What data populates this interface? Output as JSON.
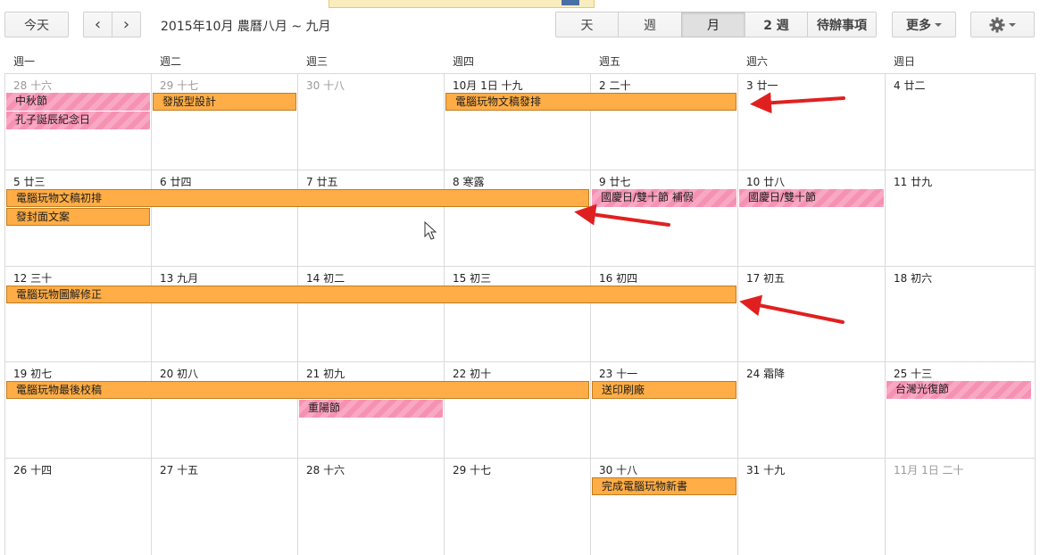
{
  "toolbar": {
    "today": "今天",
    "prev": "‹",
    "next": "›",
    "title": "2015年10月 農曆八月 ~ 九月",
    "views": [
      "天",
      "週",
      "月",
      "2 週",
      "待辦事項"
    ],
    "selected_view": "月",
    "more": "更多",
    "settings_icon": "gear-icon"
  },
  "weekdays": [
    "週一",
    "週二",
    "週三",
    "週四",
    "週五",
    "週六",
    "週日"
  ],
  "weeks": [
    [
      "28 十六",
      "29 十七",
      "30 十八",
      "10月 1日 十九",
      "2 二十",
      "3 廿一",
      "4 廿二"
    ],
    [
      "5 廿三",
      "6 廿四",
      "7 廿五",
      "8 寒露",
      "9 廿七",
      "10 廿八",
      "11 廿九"
    ],
    [
      "12 三十",
      "13 九月",
      "14 初二",
      "15 初三",
      "16 初四",
      "17 初五",
      "18 初六"
    ],
    [
      "19 初七",
      "20 初八",
      "21 初九",
      "22 初十",
      "23 十一",
      "24 霜降",
      "25 十三"
    ],
    [
      "26 十四",
      "27 十五",
      "28 十六",
      "29 十七",
      "30 十八",
      "31 十九",
      "11月 1日 二十"
    ]
  ],
  "events": {
    "e1": "中秋節",
    "e2": "孔子誕辰紀念日",
    "e3": "發版型設計",
    "e4": "電腦玩物文稿發排",
    "e5": "電腦玩物文稿初排",
    "e6": "國慶日/雙十節 補假",
    "e7": "國慶日/雙十節",
    "e8": "發封面文案",
    "e9": "電腦玩物圖解修正",
    "e10": "電腦玩物最後校稿",
    "e11": "送印刷廠",
    "e12": "台灣光復節",
    "e13": "重陽節",
    "e14": "完成電腦玩物新書"
  },
  "colors": {
    "orange": "#ffad46",
    "pink": "#f691b2",
    "arrow": "#e02020"
  }
}
